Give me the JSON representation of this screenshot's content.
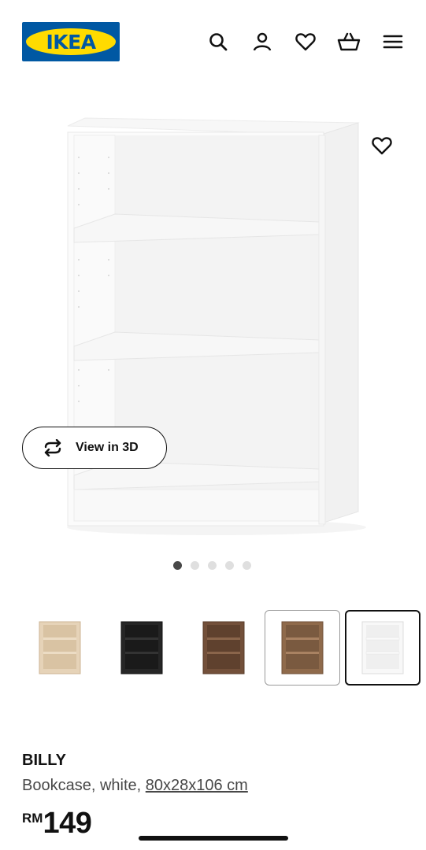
{
  "header": {
    "logo_text": "IKEA",
    "icons": [
      "search-icon",
      "user-icon",
      "heart-icon",
      "basket-icon",
      "menu-icon"
    ]
  },
  "gallery": {
    "view_3d_label": "View in 3D",
    "slide_count": 5,
    "active_slide": 1
  },
  "variants": [
    {
      "name": "birch-effect",
      "color": "#e3cfb2"
    },
    {
      "name": "black-brown",
      "color": "#232323"
    },
    {
      "name": "brown-walnut-effect",
      "color": "#6e4a32"
    },
    {
      "name": "oak-effect",
      "color": "#8c6748"
    },
    {
      "name": "white",
      "color": "#f3f3f3"
    }
  ],
  "product": {
    "name": "BILLY",
    "description": "Bookcase, white, ",
    "dimensions": "80x28x106 cm",
    "currency": "RM",
    "price": "149"
  },
  "colors": {
    "brand_blue": "#0058a3",
    "brand_yellow": "#ffdb00"
  }
}
